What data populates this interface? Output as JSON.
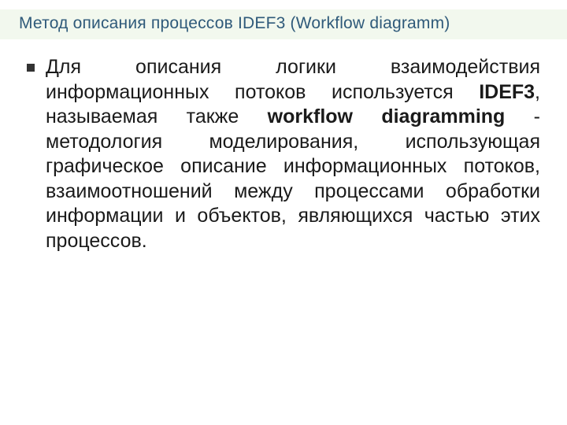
{
  "title": "Метод описания процессов IDEF3 (Workflow diagramm)",
  "body": {
    "p1_seg1": "Для описания логики взаимодействия информационных потоков используется ",
    "p1_bold1": "IDEF3",
    "p1_seg2": ", называемая также ",
    "p1_bold2": "workflow diagramming",
    "p1_seg3": " - методология моделирования, использующая графическое описание информационных потоков, взаимоотношений между процессами обработки информации и объектов, являющихся частью этих процессов."
  }
}
